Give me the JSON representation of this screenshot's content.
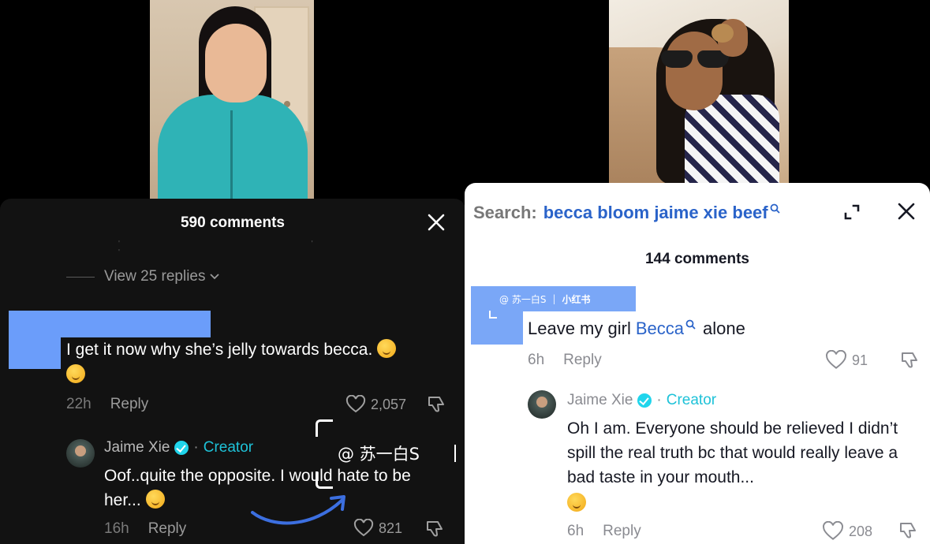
{
  "left_panel": {
    "comment_count": "590 comments",
    "view_replies": "View 25 replies",
    "comment1": {
      "text": "I get it now why she’s jelly towards becca.",
      "time": "22h",
      "reply_label": "Reply",
      "likes": "2,057"
    },
    "creator_reply": {
      "name": "Jaime Xie",
      "dot": "·",
      "badge": "Creator",
      "text": "Oof..quite the opposite. I would hate to be her...",
      "time": "16h",
      "reply_label": "Reply",
      "likes": "821"
    },
    "watermark": "@ 苏一白S"
  },
  "right_panel": {
    "search_label": "Search:",
    "search_query": "becca bloom jaime xie beef",
    "comment_count": "144 comments",
    "watermark": {
      "handle": "@ 苏一白S",
      "sep": "|",
      "brand": "小红书"
    },
    "comment1": {
      "text_before": "Leave my girl",
      "link": "Becca",
      "text_after": "alone",
      "time": "6h",
      "reply_label": "Reply",
      "likes": "91"
    },
    "creator_reply": {
      "name": "Jaime Xie",
      "dot": "·",
      "badge": "Creator",
      "text": "Oh I am. Everyone should be relieved I didn’t spill the real truth bc that would really leave a bad taste in your mouth...",
      "time": "6h",
      "reply_label": "Reply",
      "likes": "208"
    }
  },
  "colors": {
    "dark_bg": "#121212",
    "redaction": "#6b9dfa",
    "creator_teal": "#1ec2d8",
    "link_blue": "#2a63c9",
    "verified": "#20d5ec"
  },
  "icons": [
    "close-icon",
    "heart-icon",
    "dislike-icon",
    "verified-icon",
    "expand-icon",
    "search-icon",
    "chevron-down-icon"
  ]
}
